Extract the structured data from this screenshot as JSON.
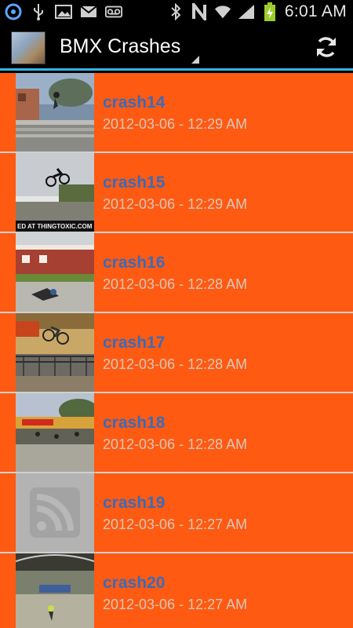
{
  "status_bar": {
    "time": "6:01 AM",
    "icons": [
      "notification-app-icon",
      "usb-icon",
      "image-icon",
      "gmail-icon",
      "voicemail-icon",
      "bluetooth-icon",
      "nfc-icon",
      "wifi-icon",
      "signal-icon",
      "battery-charging-icon"
    ]
  },
  "action_bar": {
    "title": "BMX Crashes",
    "refresh_icon": "refresh-icon",
    "accent_color": "#33b5e5"
  },
  "list": {
    "background_color": "#ff5a12",
    "items": [
      {
        "title": "crash14",
        "date": "2012-03-06 - 12:29 AM",
        "thumb": "photo"
      },
      {
        "title": "crash15",
        "date": "2012-03-06 - 12:29 AM",
        "thumb": "photo",
        "thumb_caption": "ED AT THINGTOXIC.COM"
      },
      {
        "title": "crash16",
        "date": "2012-03-06 - 12:28 AM",
        "thumb": "photo"
      },
      {
        "title": "crash17",
        "date": "2012-03-06 - 12:28 AM",
        "thumb": "photo"
      },
      {
        "title": "crash18",
        "date": "2012-03-06 - 12:28 AM",
        "thumb": "photo"
      },
      {
        "title": "crash19",
        "date": "2012-03-06 - 12:27 AM",
        "thumb": "rss-placeholder"
      },
      {
        "title": "crash20",
        "date": "2012-03-06 - 12:27 AM",
        "thumb": "photo"
      }
    ]
  }
}
